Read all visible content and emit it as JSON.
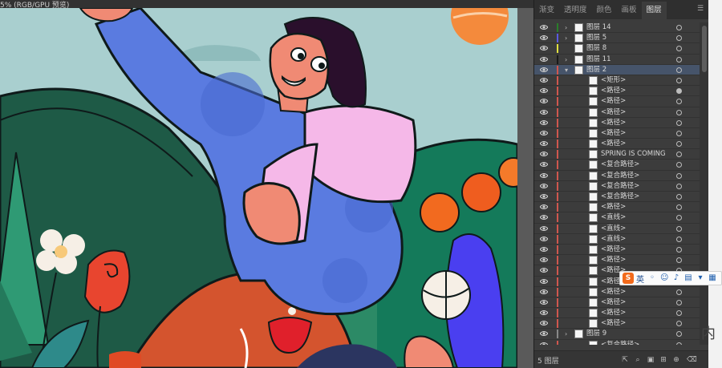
{
  "document": {
    "tab_title": "5% (RGB/GPU 预览)"
  },
  "panel": {
    "tabs": [
      {
        "label": "渐变"
      },
      {
        "label": "透明度"
      },
      {
        "label": "颜色"
      },
      {
        "label": "画板"
      },
      {
        "label": "图层"
      }
    ],
    "menu_icon": "panel-menu-icon",
    "footer": {
      "layer_count": "5 图层"
    }
  },
  "layers": [
    {
      "name": "图层 14",
      "type": "layer",
      "color": "#2a7f2a",
      "expanded": false,
      "has_children": true,
      "targeted": false
    },
    {
      "name": "图层 5",
      "type": "layer",
      "color": "#5a5ae0",
      "expanded": false,
      "has_children": true,
      "targeted": false
    },
    {
      "name": "图层 8",
      "type": "layer",
      "color": "#e0e040",
      "expanded": false,
      "has_children": false,
      "targeted": false
    },
    {
      "name": "图层 11",
      "type": "layer",
      "color": "#1a1a1a",
      "expanded": false,
      "has_children": true,
      "targeted": false
    },
    {
      "name": "图层 2",
      "type": "layer",
      "color": "#d0564e",
      "expanded": true,
      "has_children": true,
      "targeted": false,
      "selected": true
    },
    {
      "name": "<矩形>",
      "type": "sub",
      "targeted": false
    },
    {
      "name": "<路径>",
      "type": "sub",
      "targeted": true
    },
    {
      "name": "<路径>",
      "type": "sub",
      "targeted": false
    },
    {
      "name": "<路径>",
      "type": "sub",
      "targeted": false
    },
    {
      "name": "<路径>",
      "type": "sub",
      "targeted": false
    },
    {
      "name": "<路径>",
      "type": "sub",
      "targeted": false
    },
    {
      "name": "<路径>",
      "type": "sub",
      "targeted": false
    },
    {
      "name": "SPRING IS COMING",
      "type": "sub",
      "targeted": false
    },
    {
      "name": "<复合路径>",
      "type": "sub",
      "targeted": false
    },
    {
      "name": "<复合路径>",
      "type": "sub",
      "targeted": false
    },
    {
      "name": "<复合路径>",
      "type": "sub",
      "targeted": false
    },
    {
      "name": "<复合路径>",
      "type": "sub",
      "targeted": false
    },
    {
      "name": "<路径>",
      "type": "sub",
      "targeted": false
    },
    {
      "name": "<直线>",
      "type": "sub",
      "targeted": false
    },
    {
      "name": "<直线>",
      "type": "sub",
      "targeted": false
    },
    {
      "name": "<直线>",
      "type": "sub",
      "targeted": false
    },
    {
      "name": "<路径>",
      "type": "sub",
      "targeted": false
    },
    {
      "name": "<路径>",
      "type": "sub",
      "targeted": false
    },
    {
      "name": "<路径>",
      "type": "sub",
      "targeted": false
    },
    {
      "name": "<路径>",
      "type": "sub",
      "targeted": false
    },
    {
      "name": "<路径>",
      "type": "sub",
      "targeted": false
    },
    {
      "name": "<路径>",
      "type": "sub",
      "targeted": false
    },
    {
      "name": "<路径>",
      "type": "sub",
      "targeted": false
    },
    {
      "name": "<路径>",
      "type": "sub",
      "targeted": false
    },
    {
      "name": "图层 9",
      "type": "layer",
      "color": "#888888",
      "expanded": false,
      "has_children": true,
      "targeted": false
    },
    {
      "name": "<复合路径>",
      "type": "sub",
      "targeted": false
    }
  ],
  "ime_toolbar": {
    "logo": "S",
    "mode": "英",
    "icons": [
      "punctuation-icon",
      "emoji-icon",
      "microphone-icon",
      "keyboard-icon",
      "skin-icon",
      "toolbox-icon"
    ]
  },
  "background_text": "内"
}
